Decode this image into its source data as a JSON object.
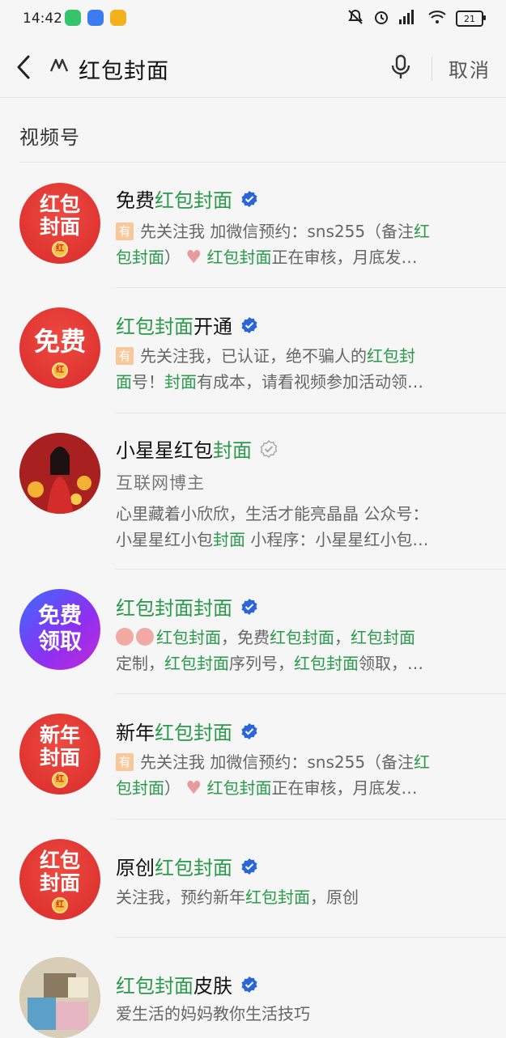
{
  "status_bar": {
    "time": "14:42",
    "battery": "21"
  },
  "search": {
    "query": "红包封面",
    "cancel_label": "取消"
  },
  "section": {
    "title": "视频号"
  },
  "results": [
    {
      "name_pre": "免费",
      "name_hl": "红包封面",
      "name_post": "",
      "verified": "blue",
      "avatar": {
        "style": "red",
        "line1": "红包",
        "line2": "封面"
      },
      "tag": "有",
      "desc_line1": [
        "先关注我 加微信预约：sns255（备注",
        "红"
      ],
      "desc_line2": [
        "包封面",
        "）",
        "红包封面",
        "正在审核，月底发…"
      ]
    },
    {
      "name_pre": "",
      "name_hl": "红包封面",
      "name_post": "开通",
      "verified": "blue",
      "avatar": {
        "style": "red",
        "line1": "免费",
        "line2": ""
      },
      "tag": "有",
      "desc_line1": [
        "先关注我，已认证，绝不骗人的",
        "红包封"
      ],
      "desc_line2": [
        "面",
        "号！",
        "封面",
        "有成本，请看视频参加活动领…"
      ]
    },
    {
      "name_pre": "小星星红包",
      "name_hl": "封面",
      "name_post": "",
      "verified": "gray",
      "subtitle": "互联网博主",
      "desc_line1": [
        "心里藏着小欣欣，生活才能亮晶晶 公众号："
      ],
      "desc_line2": [
        "小星星红小包",
        "封面",
        " 小程序：小星星红小包…"
      ]
    },
    {
      "name_pre": "",
      "name_hl": "红包封面封面",
      "name_post": "",
      "verified": "blue",
      "avatar": {
        "style": "purple",
        "line1": "免费",
        "line2": "领取"
      },
      "desc_line1": [
        "红包封面",
        "，免费",
        "红包封面",
        "，",
        "红包封面"
      ],
      "desc_line2": [
        "定制，",
        "红包封面",
        "序列号，",
        "红包封面",
        "领取，…"
      ]
    },
    {
      "name_pre": "新年",
      "name_hl": "红包封面",
      "name_post": "",
      "verified": "blue",
      "avatar": {
        "style": "red",
        "line1": "新年",
        "line2": "封面"
      },
      "tag": "有",
      "desc_line1": [
        "先关注我 加微信预约：sns255（备注",
        "红"
      ],
      "desc_line2": [
        "包封面",
        "）",
        "红包封面",
        "正在审核，月底发…"
      ]
    },
    {
      "name_pre": "原创",
      "name_hl": "红包封面",
      "name_post": "",
      "verified": "blue",
      "avatar": {
        "style": "red",
        "line1": "红包",
        "line2": "封面"
      },
      "desc_line1": [
        "关注我，预约新年",
        "红包封面",
        "，原创"
      ]
    },
    {
      "name_pre": "",
      "name_hl": "红包封面",
      "name_post": "皮肤",
      "verified": "blue",
      "desc_line1": [
        "爱生活的妈妈教你生活技巧"
      ]
    }
  ],
  "colors": {
    "highlight": "#2a9a4a",
    "verified": "#2a66d8",
    "accent_red": "#d92b2b"
  }
}
